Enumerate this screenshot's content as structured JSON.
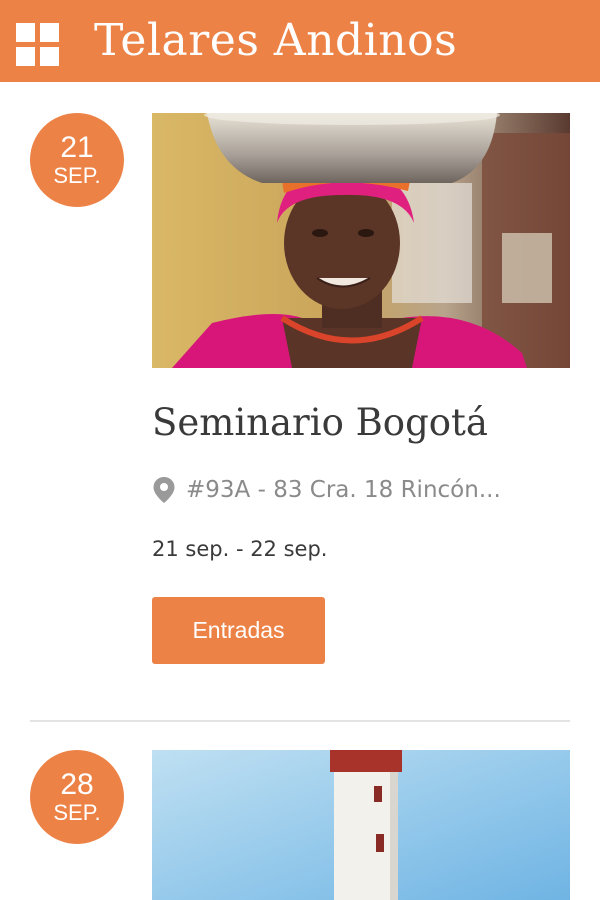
{
  "header": {
    "title": "Telares Andinos",
    "menu_icon": "grid-menu-icon",
    "color": "#ed8246"
  },
  "events": [
    {
      "day": "21",
      "month": "SEP.",
      "title": "Seminario Bogotá",
      "location": "#93A - 83 Cra. 18 Rincón...",
      "location_icon": "map-pin-icon",
      "dates": "21 sep. - 22 sep.",
      "button_label": "Entradas",
      "image": "photo-woman-with-headwrap-and-basin"
    },
    {
      "day": "28",
      "month": "SEP.",
      "image": "photo-lighthouse-blue-sky"
    }
  ]
}
